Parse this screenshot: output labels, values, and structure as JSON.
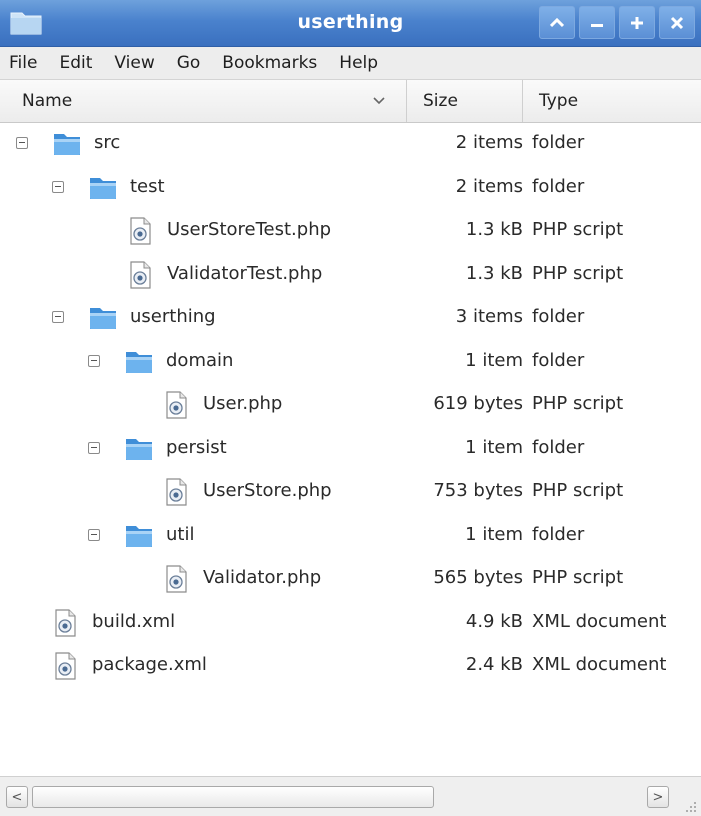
{
  "window": {
    "title": "userthing",
    "controls": [
      {
        "name": "maximize-up",
        "glyph": "^"
      },
      {
        "name": "minimize",
        "glyph": "_"
      },
      {
        "name": "plus",
        "glyph": "+"
      },
      {
        "name": "close",
        "glyph": "×"
      }
    ]
  },
  "menu": [
    "File",
    "Edit",
    "View",
    "Go",
    "Bookmarks",
    "Help"
  ],
  "columns": {
    "name": "Name",
    "size": "Size",
    "type": "Type"
  },
  "rows": [
    {
      "name": "src",
      "size": "2 items",
      "type": "folder",
      "kind": "folder",
      "depth": 0,
      "expandable": true
    },
    {
      "name": "test",
      "size": "2 items",
      "type": "folder",
      "kind": "folder",
      "depth": 1,
      "expandable": true
    },
    {
      "name": "UserStoreTest.php",
      "size": "1.3 kB",
      "type": "PHP script",
      "kind": "file",
      "depth": 2,
      "expandable": false
    },
    {
      "name": "ValidatorTest.php",
      "size": "1.3 kB",
      "type": "PHP script",
      "kind": "file",
      "depth": 2,
      "expandable": false
    },
    {
      "name": "userthing",
      "size": "3 items",
      "type": "folder",
      "kind": "folder",
      "depth": 1,
      "expandable": true
    },
    {
      "name": "domain",
      "size": "1 item",
      "type": "folder",
      "kind": "folder",
      "depth": 2,
      "expandable": true
    },
    {
      "name": "User.php",
      "size": "619 bytes",
      "type": "PHP script",
      "kind": "file",
      "depth": 3,
      "expandable": false
    },
    {
      "name": "persist",
      "size": "1 item",
      "type": "folder",
      "kind": "folder",
      "depth": 2,
      "expandable": true
    },
    {
      "name": "UserStore.php",
      "size": "753 bytes",
      "type": "PHP script",
      "kind": "file",
      "depth": 3,
      "expandable": false
    },
    {
      "name": "util",
      "size": "1 item",
      "type": "folder",
      "kind": "folder",
      "depth": 2,
      "expandable": true
    },
    {
      "name": "Validator.php",
      "size": "565 bytes",
      "type": "PHP script",
      "kind": "file",
      "depth": 3,
      "expandable": false
    },
    {
      "name": "build.xml",
      "size": "4.9 kB",
      "type": "XML document",
      "kind": "file",
      "depth": 1,
      "expandable": false
    },
    {
      "name": "package.xml",
      "size": "2.4 kB",
      "type": "XML document",
      "kind": "file",
      "depth": 1,
      "expandable": false
    }
  ],
  "scrollbar": {
    "left_arrow": "<",
    "right_arrow": ">"
  },
  "icons": {
    "window_icon": "folder-icon",
    "folder": "folder-icon",
    "file": "script-file-icon",
    "sort": "chevron-down-icon",
    "resize": "resize-grip-icon"
  },
  "colors": {
    "titlebar": "#4a82cd",
    "folder": "#4f9ee0"
  }
}
